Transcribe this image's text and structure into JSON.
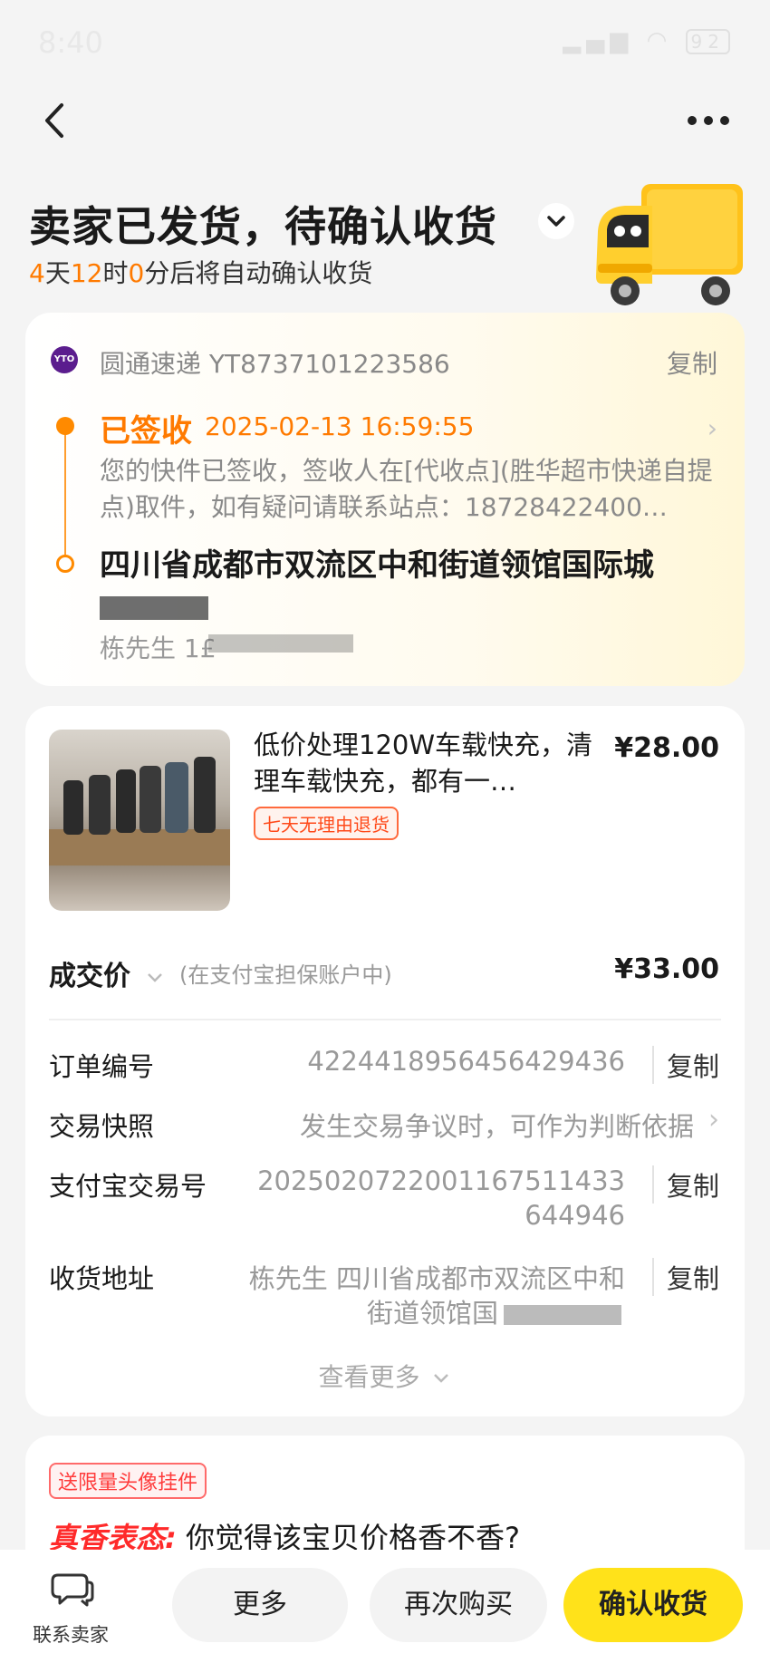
{
  "status_bar": {
    "time": "8:40",
    "battery": "92"
  },
  "header": {
    "title": "卖家已发货，待确认收货",
    "countdown": {
      "days": "4",
      "unit_day": "天",
      "hours": "12",
      "unit_hour": "时",
      "minutes": "0",
      "unit_min": "分后将自动确认收货"
    }
  },
  "logistics": {
    "carrier": "圆通速递 YT8737101223586",
    "logo_text": "YTO",
    "copy_label": "复制",
    "status": "已签收",
    "status_time": "2025-02-13 16:59:55",
    "detail": "您的快件已签收，签收人在[代收点](胜华超市快递自提点)取件，如有疑问请联系站点：18728422400…",
    "address": "四川省成都市双流区中和街道领馆国际城",
    "receiver": "栋先生 1£"
  },
  "product": {
    "title": "低价处理120W车载快充，清理车载快充，都有一…",
    "price": "¥28.00",
    "tag": "七天无理由退货"
  },
  "deal": {
    "label": "成交价",
    "note": "(在支付宝担保账户中)",
    "price": "¥33.00"
  },
  "order_info": {
    "order_no_label": "订单编号",
    "order_no": "4224418956456429436",
    "snapshot_label": "交易快照",
    "snapshot_value": "发生交易争议时，可作为判断依据",
    "alipay_label": "支付宝交易号",
    "alipay_line1": "202502072200116751143​3",
    "alipay_line2": "644946",
    "address_label": "收货地址",
    "address_line1": "栋先生 四川省成都市双流区中和",
    "address_line2": "街道领馆国",
    "copy_label": "复制",
    "see_more": "查看更多"
  },
  "promo": {
    "tag": "送限量头像挂件",
    "prefix": "真香表态:",
    "question": " 你觉得该宝贝价格香不香?"
  },
  "bottom_bar": {
    "contact_label": "联系卖家",
    "more_label": "更多",
    "rebuy_label": "再次购买",
    "confirm_label": "确认收货"
  },
  "colors": {
    "accent": "#ff7a00",
    "confirm_btn": "#ffe21a",
    "promo_red": "#ff2a2a"
  }
}
